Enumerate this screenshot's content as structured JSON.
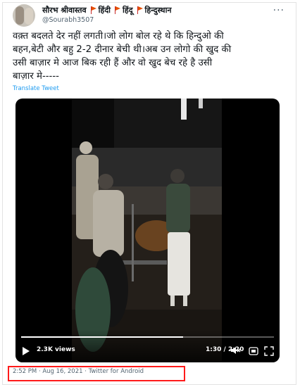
{
  "tweet": {
    "author": {
      "display_name": "सौरभ श्रीवास्तव",
      "badges": [
        "हिंदी",
        "हिंदू",
        "हिन्दुस्थान"
      ],
      "handle": "@Sourabh3507"
    },
    "text_lines": [
      "वक़्त बदलते देर नहीं लगती।जो लोग बोल रहे थे कि हिन्दुओ की",
      "बहन,बेटी और बहु 2-2 दीनार बेची थी।अब उन लोगो की खुद की",
      "उसी बाज़ार मे आज बिक रही हैं और वो खुद बेच रहे है उसी",
      "बाज़ार मे-----"
    ],
    "translate_label": "Translate Tweet",
    "video": {
      "views": "2.3K views",
      "time": "1:30 / 2:20",
      "progress": 0.64
    },
    "timestamp": "2:52 PM · Aug 16, 2021 · Twitter for Android"
  },
  "colors": {
    "link": "#1d9bf0",
    "muted": "#536471",
    "highlight": "#ff1a1a",
    "flag": "#e65100"
  },
  "icons": [
    "avatar",
    "flag-icon",
    "more-icon",
    "play-icon",
    "volume-icon",
    "gif-icon",
    "expand-icon"
  ]
}
